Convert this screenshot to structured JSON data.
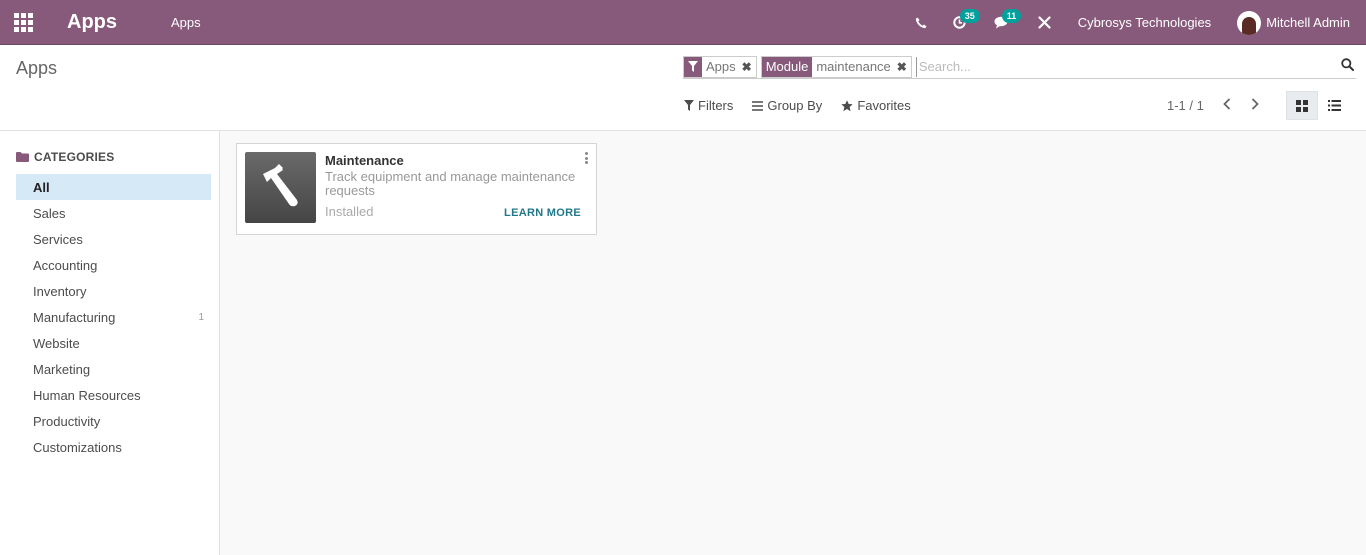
{
  "navbar": {
    "brand": "Apps",
    "menu_item": "Apps",
    "activity_count": "35",
    "message_count": "11",
    "company": "Cybrosys Technologies",
    "user": "Mitchell Admin"
  },
  "control_panel": {
    "breadcrumb": "Apps",
    "facets": [
      {
        "label": "",
        "value": "Apps"
      },
      {
        "label": "Module",
        "value": "maintenance"
      }
    ],
    "search_placeholder": "Search...",
    "filters_label": "Filters",
    "groupby_label": "Group By",
    "favorites_label": "Favorites",
    "pager": "1-1 / 1"
  },
  "sidebar": {
    "header": "CATEGORIES",
    "items": [
      {
        "label": "All",
        "count": "",
        "active": true
      },
      {
        "label": "Sales",
        "count": ""
      },
      {
        "label": "Services",
        "count": ""
      },
      {
        "label": "Accounting",
        "count": ""
      },
      {
        "label": "Inventory",
        "count": ""
      },
      {
        "label": "Manufacturing",
        "count": "1"
      },
      {
        "label": "Website",
        "count": ""
      },
      {
        "label": "Marketing",
        "count": ""
      },
      {
        "label": "Human Resources",
        "count": ""
      },
      {
        "label": "Productivity",
        "count": ""
      },
      {
        "label": "Customizations",
        "count": ""
      }
    ]
  },
  "card": {
    "title": "Maintenance",
    "description": "Track equipment and manage maintenance requests",
    "status": "Installed",
    "learn_more": "LEARN MORE",
    "icon": "hammer-wrench-icon"
  },
  "colors": {
    "brand": "#875a7b",
    "badge": "#00a09d",
    "active_category": "#d5e9f7",
    "link": "#21788a"
  }
}
